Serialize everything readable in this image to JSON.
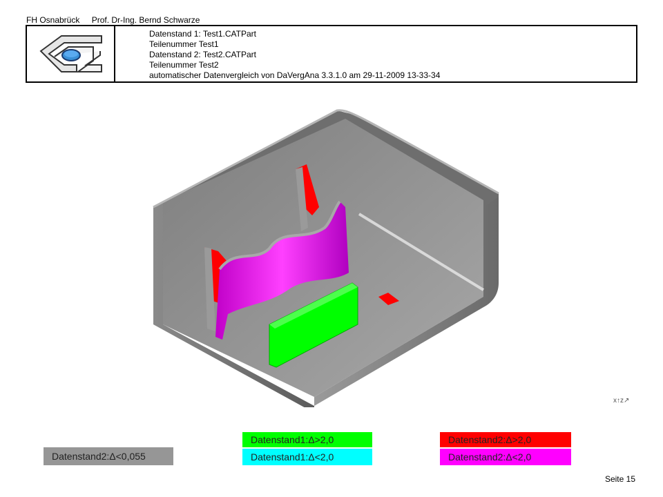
{
  "header": {
    "institution": "FH Osnabrück",
    "author": "Prof. Dr-Ing. Bernd Schwarze",
    "lines": [
      "Datenstand 1: Test1.CATPart",
      "Teilenummer  Test1",
      "Datenstand 2: Test2.CATPart",
      "Teilenummer  Test2",
      "automatischer Datenvergleich von DaVergAna 3.3.1.0 am 29-11-2009  13-33-34"
    ]
  },
  "legend": {
    "d2_small": "Datenstand2:Δ<0,055",
    "d1_large": "Datenstand1:Δ>2,0",
    "d1_small": "Datenstand1:Δ<2,0",
    "d2_large": "Datenstand2:Δ>2,0",
    "d2_mid": "Datenstand2:Δ<2,0"
  },
  "colors": {
    "gray": "#969696",
    "green": "#00ff00",
    "cyan": "#00ffff",
    "red": "#ff0000",
    "magenta": "#ff00ff"
  },
  "icons": {
    "logo": "fh-logo-icon",
    "axis": "axis-triad-icon"
  },
  "footer": {
    "page": "Seite 15"
  }
}
